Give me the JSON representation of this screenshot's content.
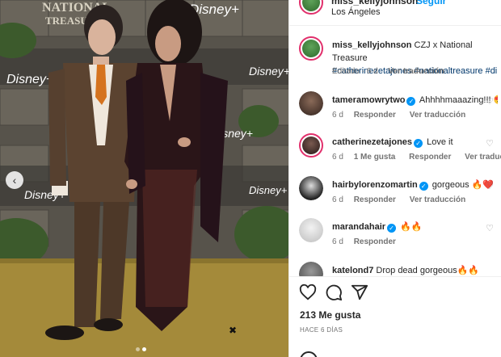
{
  "post": {
    "username": "miss_kellyjohnson",
    "follow_label": "Seguir",
    "location": "Los Ángeles"
  },
  "photo": {
    "backdrop_text": [
      "NATIONAL",
      "TREASURE",
      "Disney+"
    ],
    "carousel_prev": "‹"
  },
  "caption": {
    "username": "miss_kellyjohnson",
    "text": " CZJ x National Treasure ",
    "hashtags": "#catherinezetajones #nationaltreasure #di",
    "meta_edited": "Editado · 6 d",
    "meta_translate": "Ver traducción"
  },
  "comments": [
    {
      "username": "tameramowrytwo",
      "verified": true,
      "text": " Ahhhhmaaazing!!! 😍",
      "time": "6 d",
      "likes": "",
      "reply": "Responder",
      "translate": "Ver traducción"
    },
    {
      "username": "catherinezetajones",
      "verified": true,
      "text": " Love it",
      "time": "6 d",
      "likes": "1 Me gusta",
      "reply": "Responder",
      "translate": "Ver traducción"
    },
    {
      "username": "hairbylorenzomartin",
      "verified": true,
      "text": " gorgeous 🔥❤️",
      "time": "6 d",
      "likes": "",
      "reply": "Responder",
      "translate": "Ver traducción"
    },
    {
      "username": "marandahair",
      "verified": true,
      "text": " 🔥🔥",
      "time": "6 d",
      "likes": "",
      "reply": "Responder",
      "translate": ""
    },
    {
      "username": "katelond7",
      "verified": false,
      "text": " Drop dead gorgeous🔥🔥",
      "time": "",
      "likes": "",
      "reply": "",
      "translate": ""
    }
  ],
  "footer": {
    "likes_count": "213 Me gusta",
    "timestamp": "HACE 6 DÍAS"
  },
  "colors": {
    "link_blue": "#0095f6",
    "hashtag_blue": "#00376b",
    "muted_text": "#737373",
    "carpet_gold": "#a48a3a"
  },
  "icons": [
    "heart-icon",
    "comment-icon",
    "share-icon",
    "chevron-left-icon",
    "verified-icon"
  ]
}
